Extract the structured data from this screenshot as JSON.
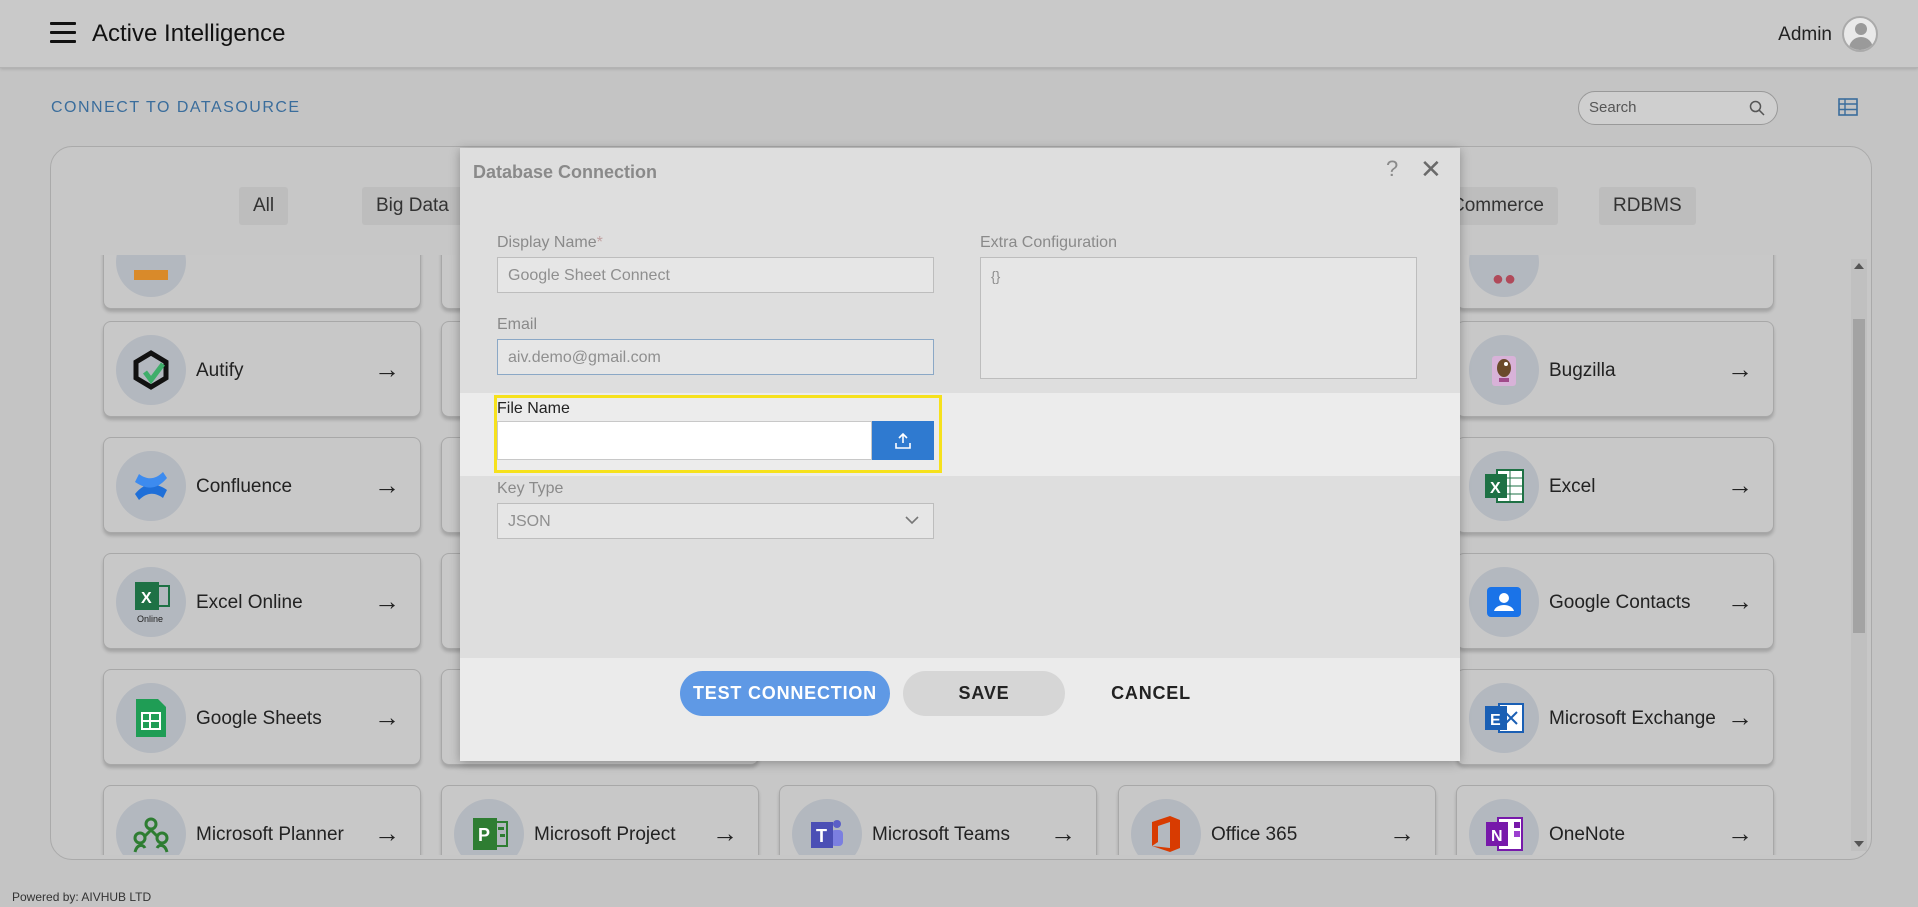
{
  "header": {
    "app_title": "Active Intelligence",
    "user_name": "Admin"
  },
  "page": {
    "title": "CONNECT TO DATASOURCE",
    "search_placeholder": "Search"
  },
  "filters": [
    "All",
    "Big Data",
    "Commerce",
    "RDBMS"
  ],
  "connectors": [
    {
      "label": "Autify",
      "icon": "autify-icon"
    },
    {
      "label": "Confluence",
      "icon": "confluence-icon"
    },
    {
      "label": "Excel Online",
      "icon": "excel-online-icon"
    },
    {
      "label": "Google Sheets",
      "icon": "google-sheets-icon"
    },
    {
      "label": "Microsoft Planner",
      "icon": "microsoft-planner-icon"
    },
    {
      "label": "Microsoft Project",
      "icon": "microsoft-project-icon"
    },
    {
      "label": "Microsoft Teams",
      "icon": "microsoft-teams-icon"
    },
    {
      "label": "Office 365",
      "icon": "office-365-icon"
    },
    {
      "label": "Bugzilla",
      "icon": "bugzilla-icon"
    },
    {
      "label": "Excel",
      "icon": "excel-icon"
    },
    {
      "label": "Google Contacts",
      "icon": "google-contacts-icon"
    },
    {
      "label": "Microsoft Exchange",
      "icon": "microsoft-exchange-icon"
    },
    {
      "label": "OneNote",
      "icon": "onenote-icon"
    }
  ],
  "modal": {
    "title": "Database Connection",
    "display_name_label": "Display Name",
    "display_name_required": "*",
    "display_name_value": "Google Sheet Connect",
    "email_label": "Email",
    "email_value": "aiv.demo@gmail.com",
    "extra_config_label": "Extra Configuration",
    "extra_config_value": "{}",
    "file_name_label": "File Name",
    "key_type_label": "Key Type",
    "key_type_value": "JSON",
    "test_connection_label": "TEST CONNECTION",
    "save_label": "SAVE",
    "cancel_label": "CANCEL"
  },
  "footer": {
    "powered_by": "Powered by: AIVHUB LTD"
  },
  "colors": {
    "accent_blue": "#2f7ad0",
    "test_button": "#5f99e5",
    "highlight_yellow": "#f6e11c",
    "title_blue": "#3a6d9c"
  }
}
